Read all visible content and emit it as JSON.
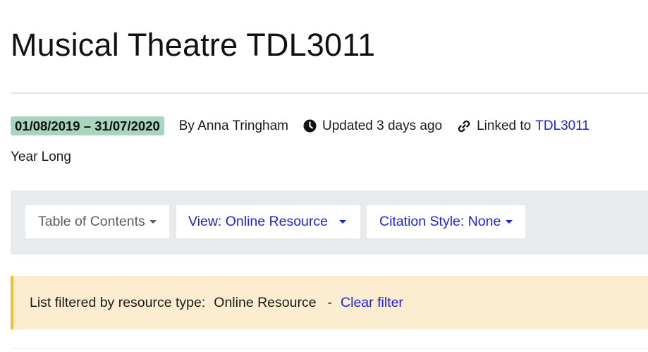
{
  "page": {
    "title": "Musical Theatre TDL3011"
  },
  "meta": {
    "date_range": "01/08/2019 – 31/07/2020",
    "author": "By Anna Tringham",
    "updated": "Updated 3 days ago",
    "linked_prefix": "Linked to",
    "linked_code": "TDL3011",
    "period": "Year Long",
    "badge_color": "#a9d4bd"
  },
  "toolbar": {
    "toc_label": "Table of Contents",
    "view_label": "View: Online Resource",
    "citation_label": "Citation Style: None"
  },
  "filter": {
    "text": "List filtered by resource type:",
    "value": "Online Resource",
    "separator": "-",
    "clear_label": "Clear filter",
    "accent_color": "#f3bf2c"
  },
  "colors": {
    "link": "#1a23d6",
    "toolbar_bg": "#e8ebee",
    "filter_bg": "#fcedd0"
  },
  "icons": {
    "updated": "clock-icon",
    "linked": "link-icon",
    "dropdown": "caret-down-icon"
  }
}
